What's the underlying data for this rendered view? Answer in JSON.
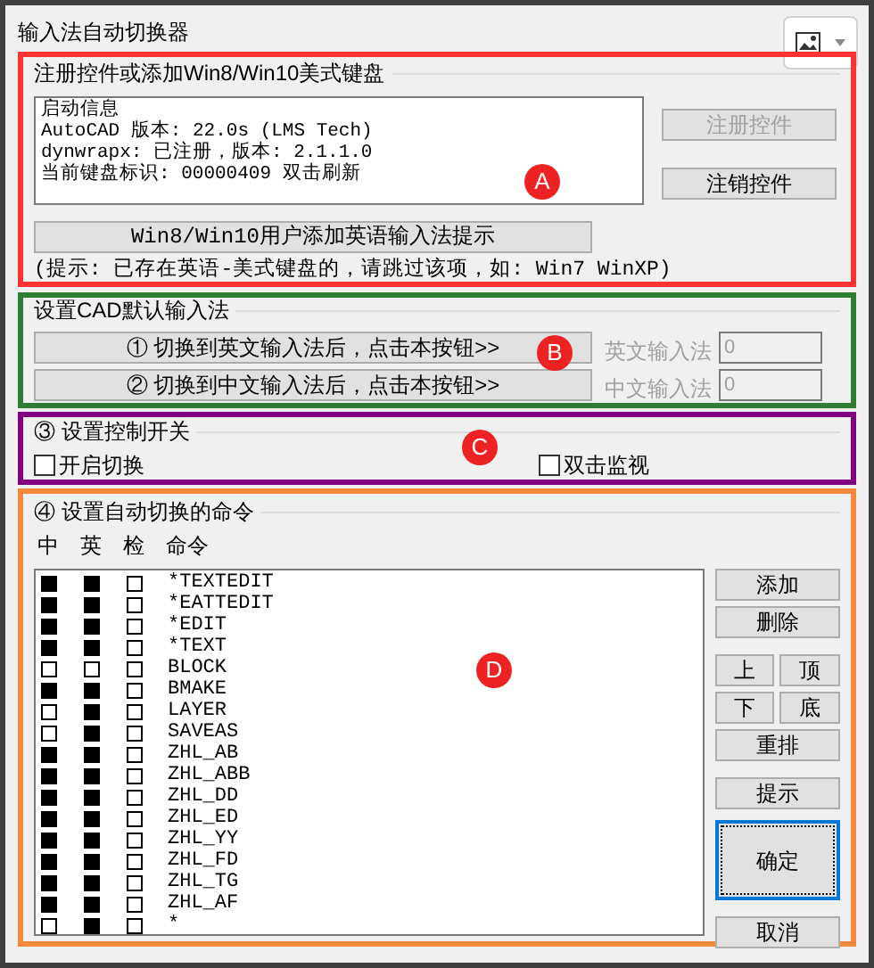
{
  "window": {
    "title": "输入法自动切换器"
  },
  "register": {
    "marker": "A",
    "color": "#ff3333",
    "group_label": "注册控件或添加Win8/Win10美式键盘",
    "info_lines": [
      "启动信息",
      "AutoCAD 版本:  22.0s (LMS Tech)",
      "dynwrapx:  已注册，版本: 2.1.1.0",
      "当前键盘标识:  00000409 双击刷新"
    ],
    "buttons": [
      {
        "label": "注册控件",
        "disabled": true
      },
      {
        "label": "注销控件",
        "disabled": false
      }
    ],
    "add_button": "Win8/Win10用户添加英语输入法提示",
    "hint": "(提示: 已存在英语-美式键盘的，请跳过该项，如: Win7 WinXP)"
  },
  "default_ime": {
    "marker": "B",
    "color": "#2e7d32",
    "group_label": "设置CAD默认输入法",
    "rows": [
      {
        "button": "① 切换到英文输入法后，点击本按钮>>",
        "label": "英文输入法",
        "value": "0"
      },
      {
        "button": "② 切换到中文输入法后，点击本按钮>>",
        "label": "中文输入法",
        "value": "0"
      }
    ]
  },
  "switches": {
    "marker": "C",
    "color": "#800080",
    "group_label": "③ 设置控制开关",
    "options": [
      {
        "label": "开启切换",
        "checked": false
      },
      {
        "label": "双击监视",
        "checked": false
      }
    ]
  },
  "commands": {
    "marker": "D",
    "color": "#f5883a",
    "group_label": "④ 设置自动切换的命令",
    "columns": [
      "中",
      "英",
      "检",
      "命令"
    ],
    "rows": [
      {
        "zh": true,
        "en": true,
        "check": false,
        "command": "*TEXTEDIT"
      },
      {
        "zh": true,
        "en": true,
        "check": false,
        "command": "*EATTEDIT"
      },
      {
        "zh": true,
        "en": true,
        "check": false,
        "command": "*EDIT"
      },
      {
        "zh": true,
        "en": true,
        "check": false,
        "command": "*TEXT"
      },
      {
        "zh": false,
        "en": false,
        "check": false,
        "command": "BLOCK"
      },
      {
        "zh": true,
        "en": true,
        "check": false,
        "command": "BMAKE"
      },
      {
        "zh": false,
        "en": true,
        "check": false,
        "command": "LAYER"
      },
      {
        "zh": false,
        "en": true,
        "check": false,
        "command": "SAVEAS"
      },
      {
        "zh": true,
        "en": true,
        "check": false,
        "command": "ZHL_AB"
      },
      {
        "zh": true,
        "en": true,
        "check": false,
        "command": "ZHL_ABB"
      },
      {
        "zh": true,
        "en": true,
        "check": false,
        "command": "ZHL_DD"
      },
      {
        "zh": true,
        "en": true,
        "check": false,
        "command": "ZHL_ED"
      },
      {
        "zh": true,
        "en": true,
        "check": false,
        "command": "ZHL_YY"
      },
      {
        "zh": true,
        "en": true,
        "check": false,
        "command": "ZHL_FD"
      },
      {
        "zh": true,
        "en": true,
        "check": false,
        "command": "ZHL_TG"
      },
      {
        "zh": true,
        "en": true,
        "check": false,
        "command": "ZHL_AF"
      },
      {
        "zh": false,
        "en": true,
        "check": false,
        "command": "*"
      }
    ],
    "buttons": {
      "add": "添加",
      "delete": "删除",
      "up": "上",
      "top": "顶",
      "down": "下",
      "bottom": "底",
      "reorder": "重排",
      "hint": "提示",
      "ok": "确定",
      "cancel": "取消"
    }
  }
}
